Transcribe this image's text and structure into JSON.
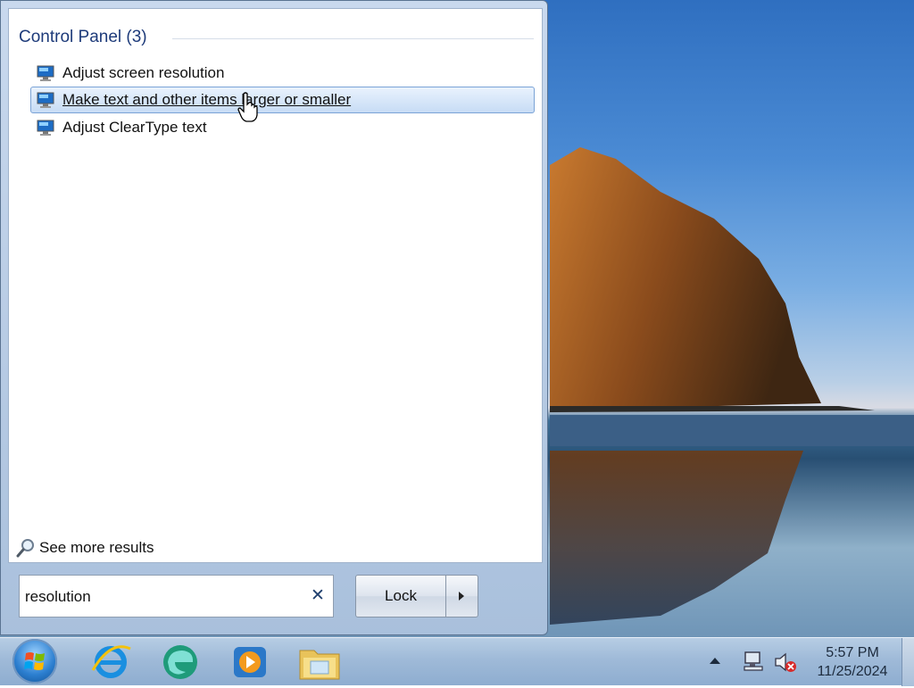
{
  "start_menu": {
    "group_header": "Control Panel (3)",
    "results": [
      {
        "label": "Adjust screen resolution",
        "icon": "display-icon"
      },
      {
        "label": "Make text and other items larger or smaller",
        "icon": "display-icon",
        "highlighted": true
      },
      {
        "label": "Adjust ClearType text",
        "icon": "display-icon"
      }
    ],
    "see_more": "See more results",
    "search": {
      "value": "resolution"
    },
    "lock_button": "Lock"
  },
  "taskbar": {
    "pinned": [
      "internet-explorer-icon",
      "edge-icon",
      "media-player-icon",
      "file-explorer-icon"
    ],
    "clock": {
      "time": "5:57 PM",
      "date": "11/25/2024"
    }
  },
  "colors": {
    "accent": "#1e3b7a",
    "highlight": "#c7dcf5"
  }
}
